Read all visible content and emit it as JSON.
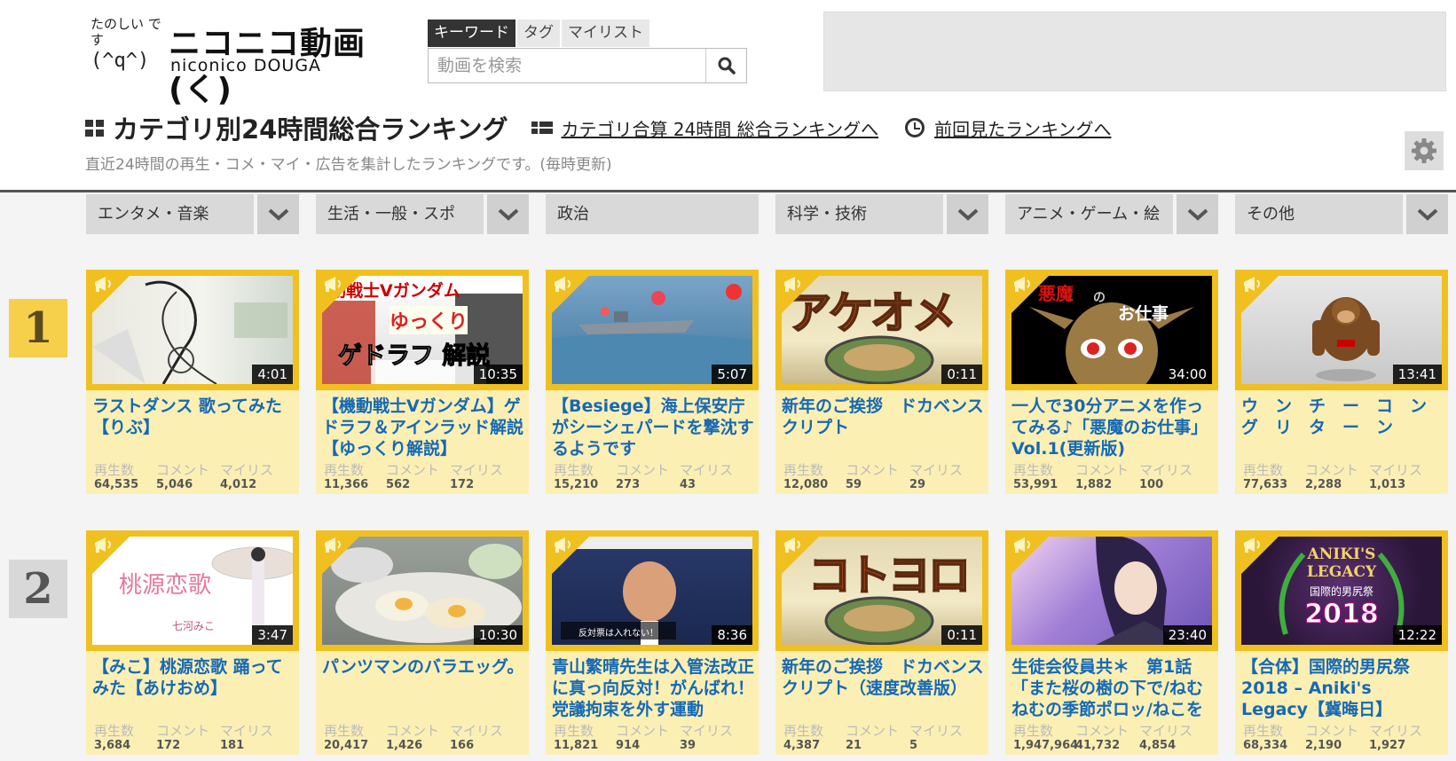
{
  "logo": {
    "tagline": "たのしい です",
    "face": "(^q^)",
    "main": "ニコニコ動画(く)",
    "sub": "niconico DOUGA"
  },
  "search": {
    "tabs": [
      "キーワード",
      "タグ",
      "マイリスト"
    ],
    "placeholder": "動画を検索"
  },
  "page": {
    "title": "カテゴリ別24時間総合ランキング",
    "link_total": "カテゴリ合算 24時間 総合ランキングへ",
    "link_previous": "前回見たランキングへ",
    "subtitle": "直近24時間の再生・コメ・マイ・広告を集計したランキングです。(毎時更新)"
  },
  "stat_labels": {
    "views": "再生数",
    "comments": "コメント",
    "mylists": "マイリス"
  },
  "categories": [
    {
      "label": "エンタメ・音楽"
    },
    {
      "label": "生活・一般・スポ"
    },
    {
      "label": "政治"
    },
    {
      "label": "科学・技術"
    },
    {
      "label": "アニメ・ゲーム・絵"
    },
    {
      "label": "その他"
    }
  ],
  "ranks": [
    "1",
    "2"
  ],
  "rows": [
    [
      {
        "title": "ラストダンス 歌ってみた【りぶ】",
        "duration": "4:01",
        "views": "64,535",
        "comments": "5,046",
        "mylists": "4,012"
      },
      {
        "title": "【機動戦士Vガンダム】ゲドラフ＆アインラッド解説【ゆっくり解説】",
        "duration": "10:35",
        "views": "11,366",
        "comments": "562",
        "mylists": "172",
        "thumb_text": [
          "動戦士Vガンダム",
          "ゆっくり",
          "ゲドラフ 解説"
        ]
      },
      {
        "title": "【Besiege】海上保安庁がシーシェパードを撃沈するようです",
        "duration": "5:07",
        "views": "15,210",
        "comments": "273",
        "mylists": "43"
      },
      {
        "title": "新年のご挨拶　ドカベンスクリプト",
        "duration": "0:11",
        "views": "12,080",
        "comments": "59",
        "mylists": "29",
        "thumb_text": [
          "アケオメ"
        ]
      },
      {
        "title": "一人で30分アニメを作ってみる♪「悪魔のお仕事」Vol.1(更新版)",
        "duration": "34:00",
        "views": "53,991",
        "comments": "1,882",
        "mylists": "100",
        "thumb_text": [
          "悪魔",
          "の",
          "お仕事"
        ]
      },
      {
        "title": "ウ　ン　チ　ー　コ　ン　グ　リ　タ　ー　ン",
        "duration": "13:41",
        "views": "77,633",
        "comments": "2,288",
        "mylists": "1,013"
      }
    ],
    [
      {
        "title": "【みこ】桃源恋歌 踊ってみた【あけおめ】",
        "duration": "3:47",
        "views": "3,684",
        "comments": "172",
        "mylists": "181",
        "thumb_text": [
          "桃源恋歌",
          "七河みこ"
        ]
      },
      {
        "title": "パンツマンのバラエッグ。",
        "duration": "10:30",
        "views": "20,417",
        "comments": "1,426",
        "mylists": "166"
      },
      {
        "title": "青山繁晴先生は入管法改正に真っ向反対！がんばれ！党議拘束を外す運動",
        "duration": "8:36",
        "views": "11,821",
        "comments": "914",
        "mylists": "39",
        "thumb_text": [
          "反対票は入れない！"
        ]
      },
      {
        "title": "新年のご挨拶　ドカベンスクリプト（速度改善版）",
        "duration": "0:11",
        "views": "4,387",
        "comments": "21",
        "mylists": "5",
        "thumb_text": [
          "コトヨロ"
        ]
      },
      {
        "title": "生徒会役員共＊　第1話「また桜の樹の下で/ねむねむの季節ポロッ/ねこを",
        "duration": "23:40",
        "views": "1,947,964",
        "comments": "41,732",
        "mylists": "4,854"
      },
      {
        "title": "【合体】国際的男尻祭2018 – Aniki's Legacy【冀晦日】",
        "duration": "12:22",
        "views": "68,334",
        "comments": "2,190",
        "mylists": "1,927",
        "thumb_text": [
          "ANIKI'S",
          "LEGACY",
          "国際的男尻祭",
          "2018"
        ]
      }
    ]
  ]
}
